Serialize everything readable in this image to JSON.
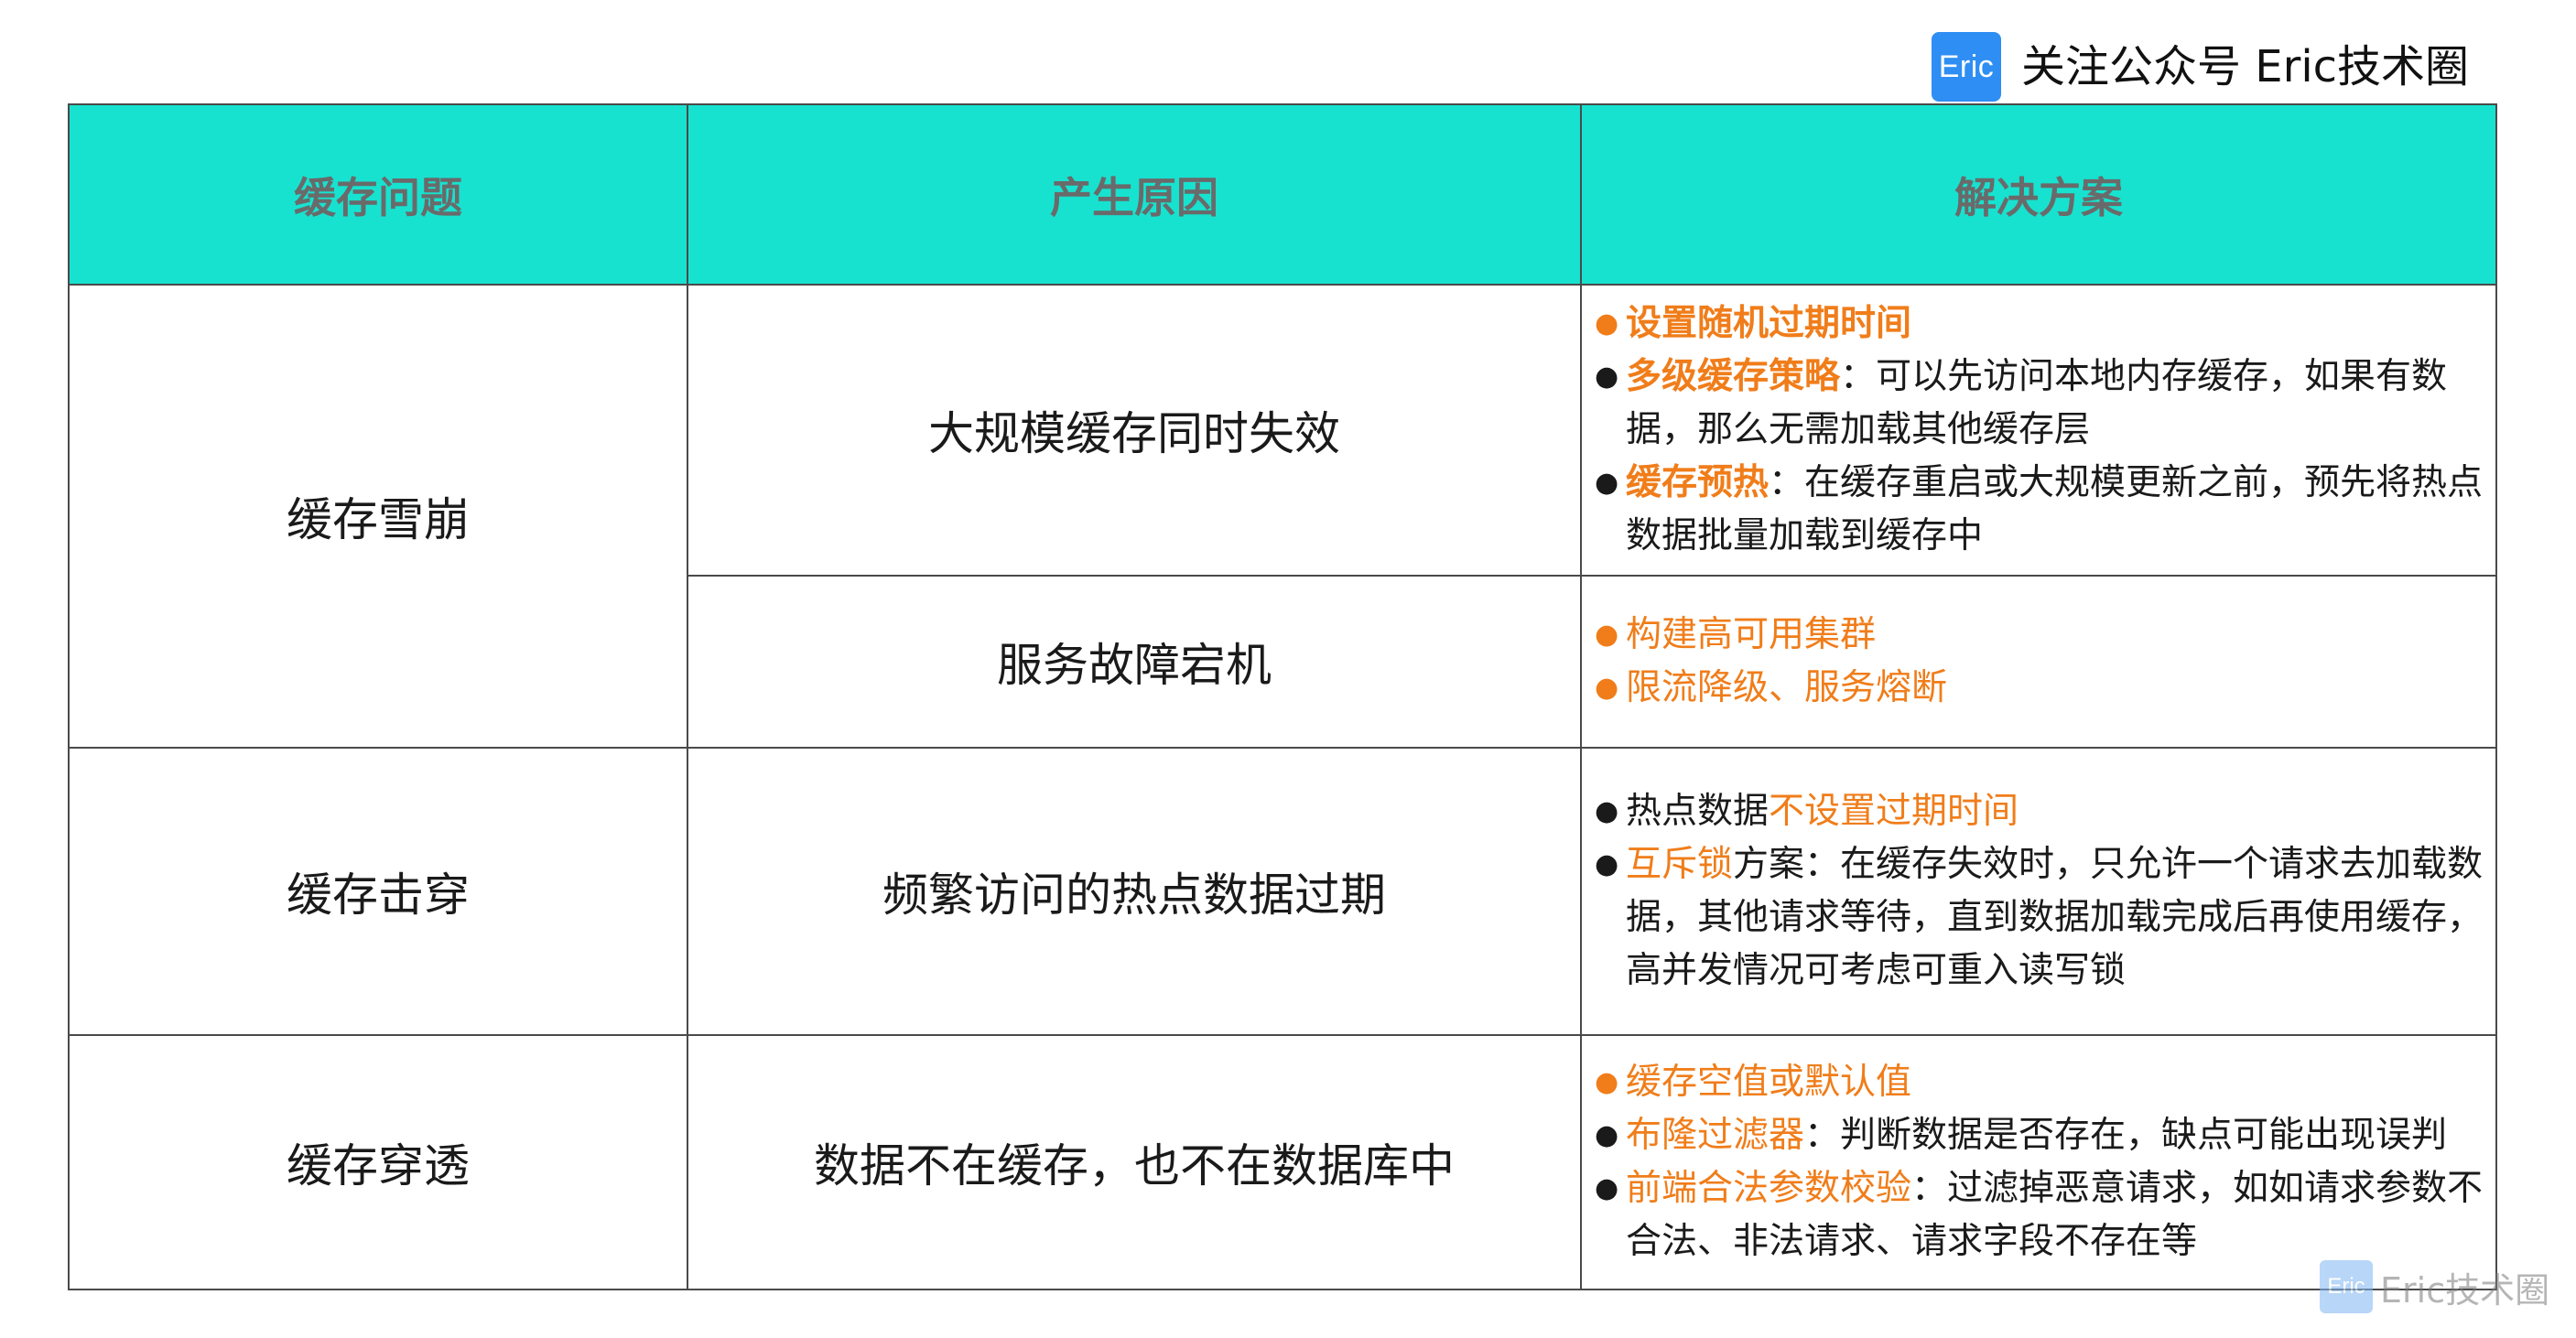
{
  "header": {
    "logo_text": "Eric",
    "brand_text": "关注公众号 Eric技术圈"
  },
  "table": {
    "headers": [
      "缓存问题",
      "产生原因",
      "解决方案"
    ],
    "rows": [
      {
        "problem": "缓存雪崩",
        "causes": [
          {
            "cause": "大规模缓存同时失效",
            "solutions": [
              {
                "key": "设置随机过期时间",
                "text": ""
              },
              {
                "key": "多级缓存策略",
                "text": "：可以先访问本地内存缓存，如果有数据，那么无需加载其他缓存层"
              },
              {
                "key": "缓存预热",
                "text": "：在缓存重启或大规模更新之前，预先将热点数据批量加载到缓存中"
              }
            ]
          },
          {
            "cause": "服务故障宕机",
            "solutions": [
              {
                "key": "构建高可用集群"
              },
              {
                "key": "限流降级、服务熔断"
              }
            ]
          }
        ]
      },
      {
        "problem": "缓存击穿",
        "cause": "频繁访问的热点数据过期",
        "solutions": [
          {
            "prefix": "热点数据",
            "key": "不设置过期时间"
          },
          {
            "key": "互斥锁",
            "text": "方案：在缓存失效时，只允许一个请求去加载数据，其他请求等待，直到数据加载完成后再使用缓存，高并发情况可考虑可重入读写锁"
          }
        ]
      },
      {
        "problem": "缓存穿透",
        "cause": "数据不在缓存，也不在数据库中",
        "solutions": [
          {
            "key": "缓存空值或默认值"
          },
          {
            "key": "布隆过滤器",
            "text": "：判断数据是否存在，缺点可能出现误判"
          },
          {
            "key": "前端合法参数校验",
            "text": "：过滤掉恶意请求，如如请求参数不合法、非法请求、请求字段不存在等"
          }
        ]
      }
    ]
  },
  "watermark": {
    "logo_text": "Eric",
    "text": "Eric技术圈"
  },
  "colors": {
    "header_bg": "#17e2cf",
    "header_text": "#6a6a6a",
    "highlight": "#f07d1a",
    "brand_logo": "#2e8ef3",
    "border": "#4a4a4a"
  }
}
